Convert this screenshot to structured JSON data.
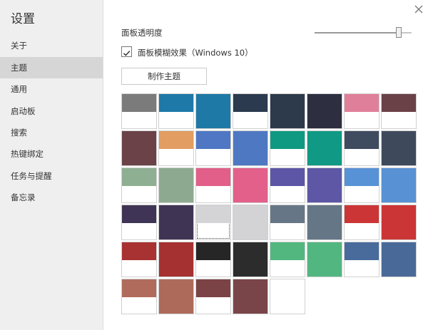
{
  "sidebar": {
    "title": "设置",
    "items": [
      {
        "label": "关于"
      },
      {
        "label": "主题",
        "active": true
      },
      {
        "label": "通用"
      },
      {
        "label": "启动板"
      },
      {
        "label": "搜索"
      },
      {
        "label": "热键绑定"
      },
      {
        "label": "任务与提醒"
      },
      {
        "label": "备忘录"
      }
    ]
  },
  "theme": {
    "opacity_label": "面板透明度",
    "opacity_value": 0.87,
    "blur_label": "面板模糊效果（Windows 10）",
    "blur_checked": true,
    "make_theme_label": "制作主题",
    "swatches": [
      {
        "color": "#7b7b7b",
        "style": "half"
      },
      {
        "color": "#1e79a8",
        "style": "half"
      },
      {
        "color": "#1f79a6",
        "style": "full"
      },
      {
        "color": "#2b3a4e",
        "style": "half"
      },
      {
        "color": "#2c3a4c",
        "style": "full"
      },
      {
        "color": "#2d2e40",
        "style": "full"
      },
      {
        "color": "#e07f9a",
        "style": "half"
      },
      {
        "color": "#6b4148",
        "style": "half"
      },
      {
        "color": "#6a4247",
        "style": "full"
      },
      {
        "color": "#e29d62",
        "style": "half"
      },
      {
        "color": "#4f77c3",
        "style": "half"
      },
      {
        "color": "#4f78c2",
        "style": "full"
      },
      {
        "color": "#0f9982",
        "style": "half"
      },
      {
        "color": "#109984",
        "style": "full"
      },
      {
        "color": "#3f4b5e",
        "style": "half"
      },
      {
        "color": "#3e4a5c",
        "style": "full"
      },
      {
        "color": "#8faf92",
        "style": "half"
      },
      {
        "color": "#8daa90",
        "style": "full"
      },
      {
        "color": "#e15f89",
        "style": "half"
      },
      {
        "color": "#e2608a",
        "style": "full"
      },
      {
        "color": "#5d56a6",
        "style": "half"
      },
      {
        "color": "#5d57a5",
        "style": "full"
      },
      {
        "color": "#5892d6",
        "style": "half"
      },
      {
        "color": "#5891d4",
        "style": "full"
      },
      {
        "color": "#3f3455",
        "style": "half"
      },
      {
        "color": "#3f3454",
        "style": "full"
      },
      {
        "color": "#d4d4d6",
        "style": "half",
        "selected": true
      },
      {
        "color": "#d3d3d5",
        "style": "full"
      },
      {
        "color": "#667687",
        "style": "half"
      },
      {
        "color": "#657686",
        "style": "full"
      },
      {
        "color": "#cc3536",
        "style": "half"
      },
      {
        "color": "#cc3535",
        "style": "full"
      },
      {
        "color": "#a83231",
        "style": "half"
      },
      {
        "color": "#a63131",
        "style": "full"
      },
      {
        "color": "#262626",
        "style": "half"
      },
      {
        "color": "#2c2c2c",
        "style": "full"
      },
      {
        "color": "#52b77f",
        "style": "half"
      },
      {
        "color": "#52b680",
        "style": "full"
      },
      {
        "color": "#496b9c",
        "style": "half"
      },
      {
        "color": "#496a99",
        "style": "full"
      },
      {
        "color": "#b06b5c",
        "style": "half"
      },
      {
        "color": "#ad6a5a",
        "style": "full"
      },
      {
        "color": "#7c4346",
        "style": "half"
      },
      {
        "color": "#7a4548",
        "style": "full"
      },
      {
        "color": "#ffffff",
        "style": "full"
      }
    ]
  }
}
